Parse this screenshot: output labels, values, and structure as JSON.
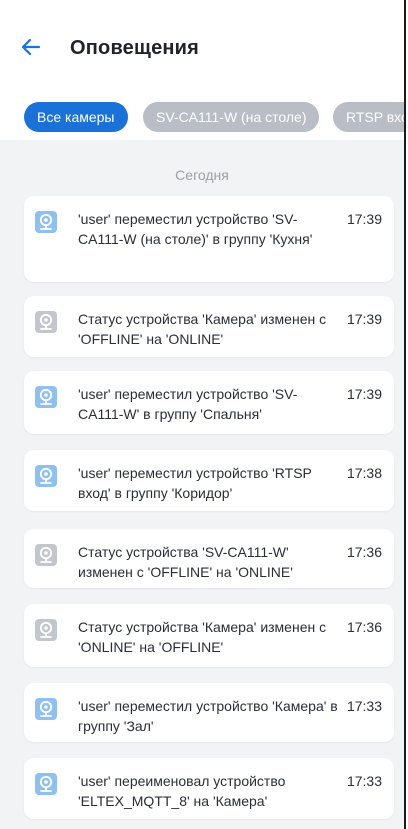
{
  "header": {
    "title": "Оповещения",
    "back_icon": "arrow-left-icon",
    "accent": "#1a72d8"
  },
  "filters": [
    {
      "label": "Все камеры",
      "active": true
    },
    {
      "label": "SV-CA111-W (на столе)",
      "active": false
    },
    {
      "label": "RTSP вход",
      "active": false
    }
  ],
  "section": "Сегодня",
  "notifications": [
    {
      "text": "'user' переместил устройство 'SV-CA111-W (на столе)' в группу 'Кухня'",
      "time": "17:39",
      "icon": "camera-icon",
      "icon_color": "#8fc0ee"
    },
    {
      "text": "Статус устройства 'Камера' изменен с 'OFFLINE' на 'ONLINE'",
      "time": "17:39",
      "icon": "camera-icon",
      "icon_color": "#c3c6cc"
    },
    {
      "text": "'user' переместил устройство 'SV-CA111-W' в группу 'Спальня'",
      "time": "17:39",
      "icon": "camera-icon",
      "icon_color": "#8fc0ee"
    },
    {
      "text": "'user' переместил устройство 'RTSP вход' в группу 'Коридор'",
      "time": "17:38",
      "icon": "camera-icon",
      "icon_color": "#8fc0ee"
    },
    {
      "text": "Статус устройства 'SV-CA111-W' изменен с 'OFFLINE' на 'ONLINE'",
      "time": "17:36",
      "icon": "camera-icon",
      "icon_color": "#c3c6cc"
    },
    {
      "text": "Статус устройства 'Камера' изменен с 'ONLINE' на 'OFFLINE'",
      "time": "17:36",
      "icon": "camera-icon",
      "icon_color": "#c3c6cc"
    },
    {
      "text": "'user' переместил устройство 'Камера' в группу 'Зал'",
      "time": "17:33",
      "icon": "camera-icon",
      "icon_color": "#8fc0ee"
    },
    {
      "text": "'user' переименовал устройство 'ELTEX_MQTT_8' на 'Камера'",
      "time": "17:33",
      "icon": "camera-icon",
      "icon_color": "#8fc0ee"
    }
  ]
}
